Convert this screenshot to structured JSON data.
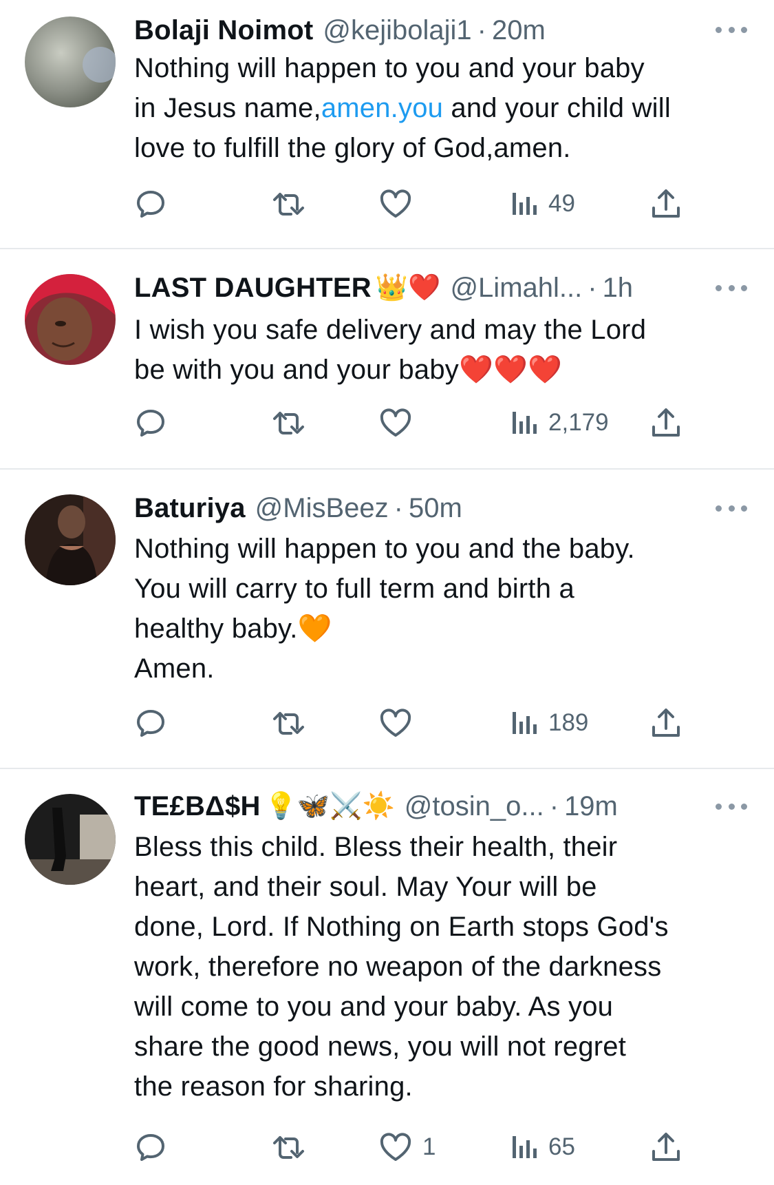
{
  "tweets": [
    {
      "name": "Bolaji Noimot",
      "emoji": "",
      "handle": "@kejibolaji1",
      "time": "20m",
      "lines": [
        {
          "parts": [
            {
              "t": "Nothing will happen to you and your baby",
              "link": false
            }
          ]
        },
        {
          "parts": [
            {
              "t": "in Jesus name,",
              "link": false
            },
            {
              "t": "amen.you",
              "link": true
            },
            {
              "t": " and your child will",
              "link": false
            }
          ]
        },
        {
          "parts": [
            {
              "t": "love to fulfill the glory of God,amen.",
              "link": false
            }
          ]
        }
      ],
      "likes": "",
      "views": "49",
      "avatar_colors": [
        "#8d9188",
        "#c9ccc2",
        "#6a7063"
      ]
    },
    {
      "name": "LAST DAUGHTER",
      "emoji": "👑❤️",
      "handle": "@Limahl...",
      "time": "1h",
      "lines": [
        {
          "parts": [
            {
              "t": "I wish you safe delivery and may the Lord",
              "link": false
            }
          ]
        },
        {
          "parts": [
            {
              "t": "be with you and your baby❤️❤️❤️",
              "link": false
            }
          ]
        }
      ],
      "likes": "",
      "views": "2,179",
      "avatar_colors": [
        "#d4213d",
        "#8a5a44",
        "#f0c9b5"
      ]
    },
    {
      "name": "Baturiya",
      "emoji": "",
      "handle": "@MisBeez",
      "time": "50m",
      "lines": [
        {
          "parts": [
            {
              "t": "Nothing will happen to you and the baby.",
              "link": false
            }
          ]
        },
        {
          "parts": [
            {
              "t": "You will carry to full term and birth a",
              "link": false
            }
          ]
        },
        {
          "parts": [
            {
              "t": "healthy baby.🧡",
              "link": false
            }
          ]
        },
        {
          "parts": [
            {
              "t": "Amen.",
              "link": false
            }
          ]
        }
      ],
      "likes": "",
      "views": "189",
      "avatar_colors": [
        "#2a1d18",
        "#6b4a3a",
        "#a8725a"
      ]
    },
    {
      "name": "TE£BΔ$H",
      "emoji": "💡🦋⚔️☀️",
      "handle": "@tosin_o...",
      "time": "19m",
      "lines": [
        {
          "parts": [
            {
              "t": "Bless this child. Bless their health, their",
              "link": false
            }
          ]
        },
        {
          "parts": [
            {
              "t": "heart, and their soul. May Your will be",
              "link": false
            }
          ]
        },
        {
          "parts": [
            {
              "t": "done, Lord. If Nothing on Earth stops God's",
              "link": false
            }
          ]
        },
        {
          "parts": [
            {
              "t": "work,  therefore no weapon of the darkness",
              "link": false
            }
          ]
        },
        {
          "parts": [
            {
              "t": "will come to you and your baby. As you",
              "link": false
            }
          ]
        },
        {
          "parts": [
            {
              "t": "share the good news, you will not regret",
              "link": false
            }
          ]
        },
        {
          "parts": [
            {
              "t": "the reason for sharing.",
              "link": false
            }
          ]
        }
      ],
      "likes": "1",
      "views": "65",
      "avatar_colors": [
        "#1c1c1c",
        "#5a5148",
        "#b9b2a6"
      ]
    }
  ],
  "icons": {
    "reply": "reply-icon",
    "retweet": "retweet-icon",
    "like": "heart-icon",
    "views": "analytics-icon",
    "share": "share-icon",
    "more": "more-options-icon"
  },
  "colors": {
    "text": "#0f1419",
    "secondary": "#536471",
    "link": "#1d9bf0",
    "divider": "#e6e9ec"
  }
}
